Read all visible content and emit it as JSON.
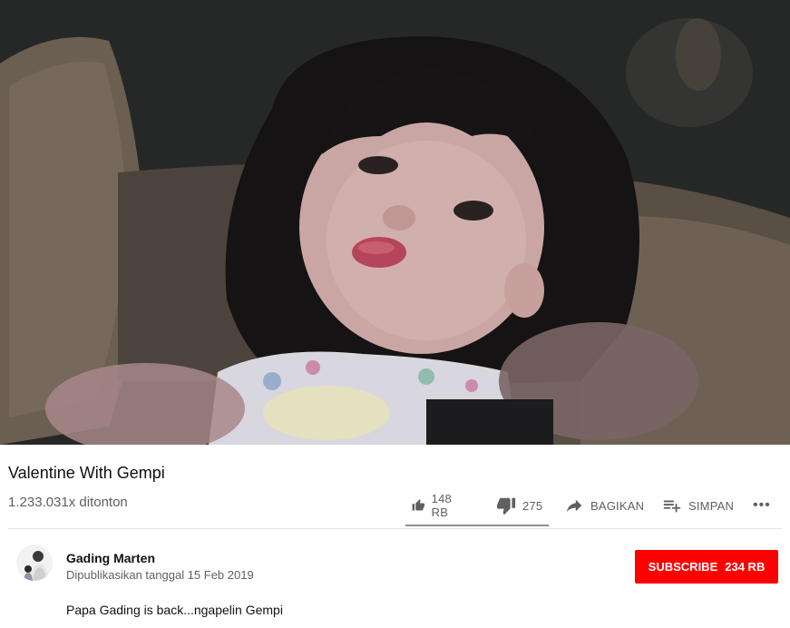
{
  "video": {
    "title": "Valentine With Gempi",
    "views": "1.233.031x ditonton",
    "thumbnail_subject": "girl-blowing-kiss-photo"
  },
  "actions": {
    "like_icon": "thumbs-up-icon",
    "like_count": "148 RB",
    "dislike_icon": "thumbs-down-icon",
    "dislike_count": "275",
    "share_icon": "share-arrow-icon",
    "share_label": "BAGIKAN",
    "save_icon": "playlist-add-icon",
    "save_label": "SIMPAN",
    "more_icon": "more-horizontal-icon",
    "more_label": "•••",
    "like_ratio": 0.998
  },
  "channel": {
    "name": "Gading Marten",
    "published": "Dipublikasikan tanggal 15 Feb 2019",
    "subscribe_label": "SUBSCRIBE",
    "subscriber_count": "234 RB",
    "description": "Papa Gading is back...ngapelin Gempi"
  },
  "colors": {
    "subscribe_bg": "#ff0000",
    "secondary_text": "#606060"
  }
}
